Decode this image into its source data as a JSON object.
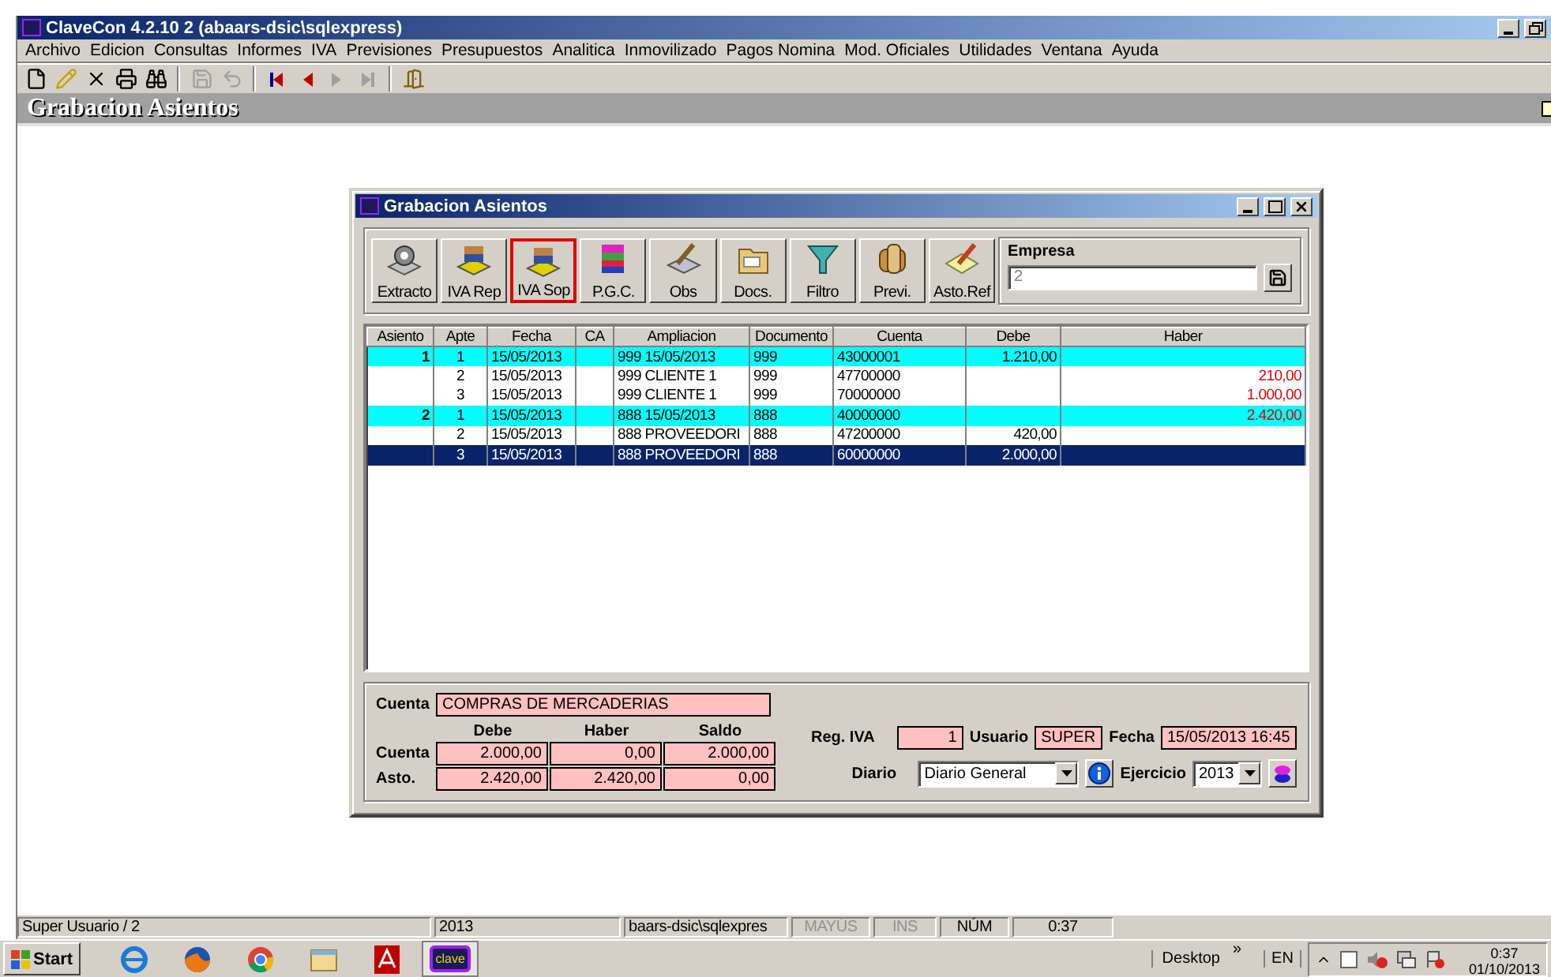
{
  "window": {
    "title": "ClaveCon 4.2.10 2 (abaars-dsic\\sqlexpress)"
  },
  "menu": [
    "Archivo",
    "Edicion",
    "Consultas",
    "Informes",
    "IVA",
    "Previsiones",
    "Presupuestos",
    "Analitica",
    "Inmovilizado",
    "Pagos Nomina",
    "Mod. Oficiales",
    "Utilidades",
    "Ventana",
    "Ayuda"
  ],
  "toolbar": [
    {
      "kind": "new",
      "disabled": false
    },
    {
      "kind": "edit",
      "disabled": false
    },
    {
      "kind": "delete",
      "disabled": false
    },
    {
      "kind": "print",
      "disabled": false
    },
    {
      "kind": "find",
      "disabled": false
    },
    {
      "kind": "sep"
    },
    {
      "kind": "save",
      "disabled": true
    },
    {
      "kind": "undo",
      "disabled": true
    },
    {
      "kind": "sep"
    },
    {
      "kind": "first",
      "disabled": false
    },
    {
      "kind": "prev",
      "disabled": false
    },
    {
      "kind": "next",
      "disabled": true
    },
    {
      "kind": "last",
      "disabled": true
    },
    {
      "kind": "sep"
    },
    {
      "kind": "exit",
      "disabled": false
    }
  ],
  "heading": "Grabacion Asientos",
  "dialog": {
    "title": "Grabacion Asientos",
    "buttons": [
      {
        "label": "Extracto",
        "kind": "gear",
        "selected": false
      },
      {
        "label": "IVA Rep",
        "kind": "books",
        "selected": false
      },
      {
        "label": "IVA Sop",
        "kind": "books",
        "selected": true
      },
      {
        "label": "P.G.C.",
        "kind": "colorbooks",
        "selected": false
      },
      {
        "label": "Obs",
        "kind": "pencil",
        "selected": false
      },
      {
        "label": "Docs.",
        "kind": "folder",
        "selected": false
      },
      {
        "label": "Filtro",
        "kind": "funnel",
        "selected": false
      },
      {
        "label": "Previ.",
        "kind": "scroll",
        "selected": false
      },
      {
        "label": "Asto.Ref",
        "kind": "note",
        "selected": false
      }
    ],
    "empresa": {
      "label": "Empresa",
      "value": "2"
    },
    "table": {
      "columns": [
        "Asiento",
        "Apte",
        "Fecha",
        "CA",
        "Ampliacion",
        "Documento",
        "Cuenta",
        "Debe",
        "Haber"
      ],
      "rows": [
        {
          "asiento": "1",
          "apte": "1",
          "fecha": "15/05/2013",
          "ampliacion": "999 15/05/2013",
          "documento": "999",
          "cuenta": "43000001",
          "debe": "1.210,00",
          "highlighted": true,
          "selected": false
        },
        {
          "apte": "2",
          "fecha": "15/05/2013",
          "ampliacion": "999 CLIENTE 1",
          "documento": "999",
          "cuenta": "47700000",
          "haber": "210,00",
          "highlighted": false,
          "selected": false
        },
        {
          "apte": "3",
          "fecha": "15/05/2013",
          "ampliacion": "999 CLIENTE 1",
          "documento": "999",
          "cuenta": "70000000",
          "haber": "1.000,00",
          "highlighted": false,
          "selected": false
        },
        {
          "asiento": "2",
          "apte": "1",
          "fecha": "15/05/2013",
          "ampliacion": "888 15/05/2013",
          "documento": "888",
          "cuenta": "40000000",
          "haber": "2.420,00",
          "highlighted": true,
          "selected": false
        },
        {
          "apte": "2",
          "fecha": "15/05/2013",
          "ampliacion": "888 PROVEEDORI",
          "documento": "888",
          "cuenta": "47200000",
          "debe": "420,00",
          "highlighted": false,
          "selected": false
        },
        {
          "apte": "3",
          "fecha": "15/05/2013",
          "ampliacion": "888 PROVEEDORI",
          "documento": "888",
          "cuenta": "60000000",
          "debe": "2.000,00",
          "highlighted": false,
          "selected": true
        }
      ]
    },
    "footer": {
      "cuenta_label": "Cuenta",
      "cuenta_name": "COMPRAS DE MERCADERIAS",
      "totals_headers": [
        "Debe",
        "Haber",
        "Saldo"
      ],
      "totals": [
        {
          "label": "Cuenta",
          "values": [
            "2.000,00",
            "0,00",
            "2.000,00"
          ]
        },
        {
          "label": "Asto.",
          "values": [
            "2.420,00",
            "2.420,00",
            "0,00"
          ]
        }
      ],
      "reg_iva_label": "Reg. IVA",
      "reg_iva": "1",
      "usuario_label": "Usuario",
      "usuario": "SUPER",
      "fecha_label": "Fecha",
      "fecha": "15/05/2013 16:45",
      "diario_label": "Diario",
      "diario": "Diario General",
      "ejercicio_label": "Ejercicio",
      "ejercicio": "2013"
    }
  },
  "status_bar": [
    {
      "text": "Super Usuario / 2",
      "disabled": false
    },
    {
      "text": "2013",
      "disabled": false
    },
    {
      "text": "baars-dsic\\sqlexpres",
      "disabled": false
    },
    {
      "text": "MAYÚS",
      "disabled": true
    },
    {
      "text": "INS",
      "disabled": true
    },
    {
      "text": "NÚM",
      "disabled": false
    },
    {
      "text": "0:37",
      "disabled": false
    }
  ],
  "taskbar": {
    "start": "Start",
    "apps": [
      {
        "kind": "ie",
        "selected": false
      },
      {
        "kind": "firefox",
        "selected": false
      },
      {
        "kind": "chrome",
        "selected": false
      },
      {
        "kind": "explorer",
        "selected": false
      },
      {
        "kind": "pdf",
        "selected": false
      },
      {
        "kind": "clave",
        "label": "clave",
        "selected": true
      }
    ],
    "desktop": "Desktop",
    "chevron": "»",
    "language": "EN",
    "time": "0:37",
    "date": "01/10/2013"
  }
}
